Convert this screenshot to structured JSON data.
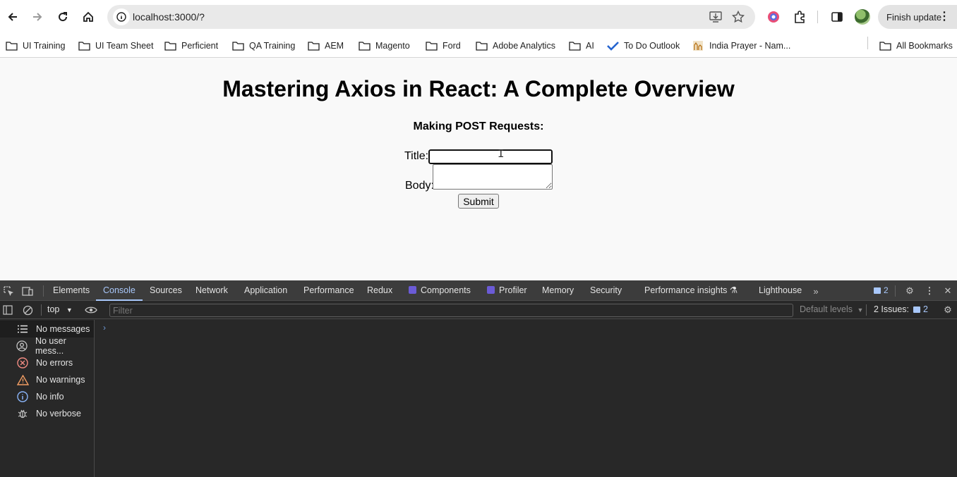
{
  "browser": {
    "url": "localhost:3000/?",
    "finish_update_label": "Finish update",
    "bookmarks": [
      {
        "label": "UI Training",
        "icon": "folder-icon"
      },
      {
        "label": "UI Team Sheet",
        "icon": "folder-icon"
      },
      {
        "label": "Perficient",
        "icon": "folder-icon"
      },
      {
        "label": "QA Training",
        "icon": "folder-icon"
      },
      {
        "label": "AEM",
        "icon": "folder-icon"
      },
      {
        "label": "Magento",
        "icon": "folder-icon"
      },
      {
        "label": "Ford",
        "icon": "folder-icon"
      },
      {
        "label": "Adobe Analytics",
        "icon": "folder-icon"
      },
      {
        "label": "AI",
        "icon": "folder-icon"
      },
      {
        "label": "To Do Outlook",
        "icon": "checkmark-icon"
      },
      {
        "label": "India Prayer  - Nam...",
        "icon": "bookmark-favicon-icon"
      }
    ],
    "all_bookmarks_label": "All Bookmarks"
  },
  "page": {
    "heading": "Mastering Axios in React: A Complete Overview",
    "subheading": "Making POST Requests:",
    "title_label": "Title:",
    "title_value": "",
    "body_label": "Body:",
    "body_value": "",
    "submit_label": "Submit"
  },
  "devtools": {
    "tabs": [
      "Elements",
      "Console",
      "Sources",
      "Network",
      "Application",
      "Performance",
      "Redux",
      "Components",
      "Profiler",
      "Memory",
      "Security",
      "Performance insights",
      "Lighthouse"
    ],
    "active_tab": "Console",
    "issues_badge_count": "2",
    "context": "top",
    "filter_placeholder": "Filter",
    "default_levels": "Default levels",
    "issues_label": "2 Issues:",
    "issues_count": "2",
    "sidebar": [
      {
        "label": "No messages",
        "icon": "list-icon"
      },
      {
        "label": "No user mess...",
        "icon": "user-icon"
      },
      {
        "label": "No errors",
        "icon": "error-icon"
      },
      {
        "label": "No warnings",
        "icon": "warning-icon"
      },
      {
        "label": "No info",
        "icon": "info-icon"
      },
      {
        "label": "No verbose",
        "icon": "bug-icon"
      }
    ],
    "prompt_symbol": "›"
  },
  "colors": {
    "active_tab": "#a8c7fa",
    "error": "#f28b82",
    "warning": "#fdd663",
    "info": "#8ab4f8"
  }
}
